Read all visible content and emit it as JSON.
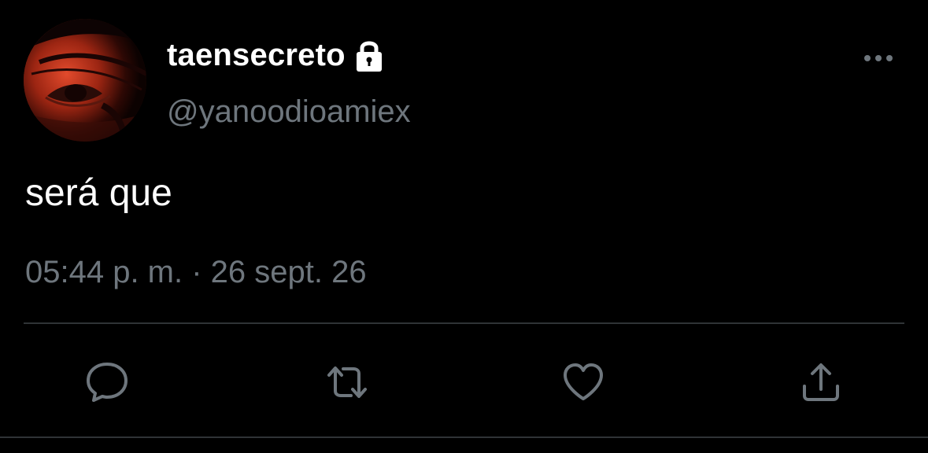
{
  "tweet": {
    "display_name": "taensecreto",
    "handle": "@yanoodioamiex",
    "text": "será que",
    "timestamp": "05:44 p. m. · 26 sept. 26",
    "protected_icon": "lock-icon"
  },
  "actions": [
    {
      "name": "reply",
      "icon": "comment-icon"
    },
    {
      "name": "retweet",
      "icon": "retweet-icon"
    },
    {
      "name": "like",
      "icon": "heart-icon"
    },
    {
      "name": "share",
      "icon": "share-icon"
    }
  ],
  "colors": {
    "background": "#000000",
    "primary_text": "#ffffff",
    "secondary_text": "#6e767d",
    "divider": "#2f3336",
    "icon": "#6e767d"
  }
}
